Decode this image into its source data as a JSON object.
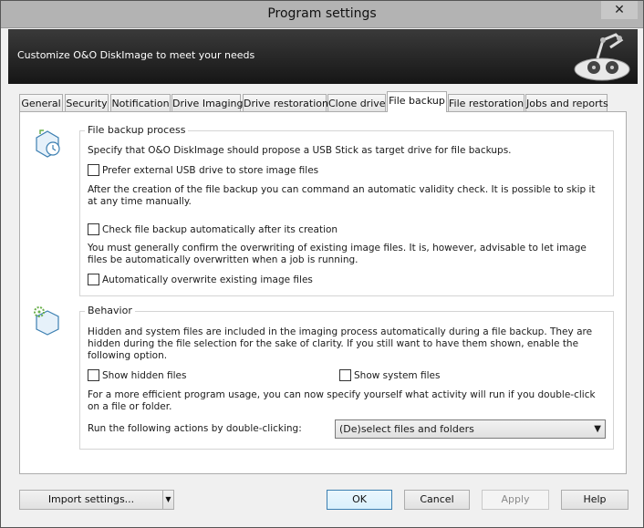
{
  "window": {
    "title": "Program settings",
    "close_glyph": "✕"
  },
  "banner": {
    "text": "Customize O&O DiskImage to meet your needs"
  },
  "tabs": [
    "General",
    "Security",
    "Notification",
    "Drive Imaging",
    "Drive restoration",
    "Clone drive",
    "File backup",
    "File restoration",
    "Jobs and reports"
  ],
  "file_backup": {
    "title": "File backup process",
    "usb_text": "Specify that O&O DiskImage should propose a USB Stick as target drive for file backups.",
    "usb_checkbox": "Prefer external USB drive to store image files",
    "validity_text": "After the creation of the file backup you can command an automatic validity check. It is possible to skip it at any time manually.",
    "check_checkbox": "Check file backup automatically after its creation",
    "overwrite_text": "You must generally confirm the overwriting of existing image files. It is, however, advisable to let image files be automatically overwritten when a job is running.",
    "overwrite_checkbox": "Automatically overwrite existing image files"
  },
  "behavior": {
    "title": "Behavior",
    "hidden_text": "Hidden and system files are included in the imaging process automatically during a file backup. They are hidden during the file selection for the sake of clarity. If you still want to have them shown, enable the following option.",
    "show_hidden": "Show hidden files",
    "show_system": "Show system files",
    "dblclick_text": "For a more efficient program usage, you can now specify yourself what activity will run if you double-click on a file or folder.",
    "dblclick_label": "Run the following actions by double-clicking:",
    "dblclick_value": "(De)select files and folders"
  },
  "buttons": {
    "import": "Import settings...",
    "ok": "OK",
    "cancel": "Cancel",
    "apply": "Apply",
    "help": "Help"
  }
}
